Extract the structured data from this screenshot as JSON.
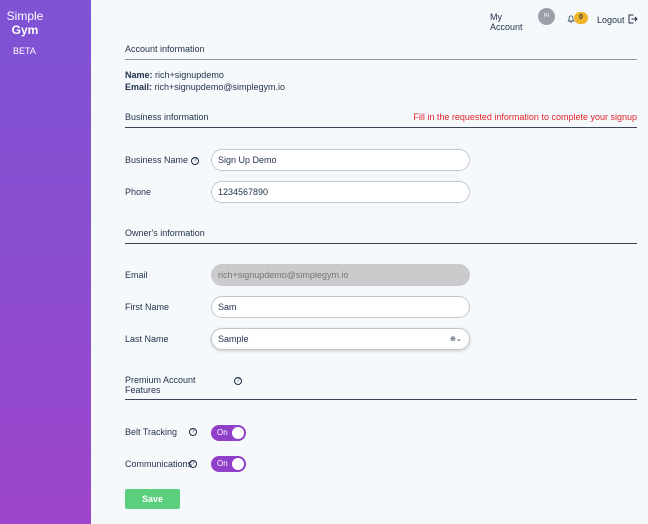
{
  "sidebar": {
    "brand_top": "Simple",
    "brand_bottom": "Gym",
    "beta": "BETA"
  },
  "topbar": {
    "account_label": "My Account",
    "avatar_initials": "RI",
    "notification_count": "0",
    "logout_label": "Logout"
  },
  "account_info": {
    "title": "Account information",
    "name_label": "Name:",
    "name_value": "rich+signupdemo",
    "email_label": "Email:",
    "email_value": "rich+signupdemo@simplegym.io"
  },
  "business_info": {
    "title": "Business information",
    "warning": "Fill in the requested information to complete your signup",
    "business_name_label": "Business Name",
    "business_name_value": "Sign Up Demo",
    "phone_label": "Phone",
    "phone_value": "1234567890"
  },
  "owner_info": {
    "title": "Owner's information",
    "email_label": "Email",
    "email_placeholder": "rich+signupdemo@simplegym.io",
    "first_name_label": "First Name",
    "first_name_value": "Sam",
    "last_name_label": "Last Name",
    "last_name_value": "Sample"
  },
  "premium": {
    "title": "Premium Account Features",
    "belt_tracking_label": "Belt Tracking",
    "belt_tracking_state": "On",
    "communications_label": "Communications",
    "communications_state": "On"
  },
  "actions": {
    "save_label": "Save"
  },
  "colors": {
    "sidebar_top": "#7e53d4",
    "sidebar_bottom": "#9d45cc",
    "toggle_on": "#8f3fc8",
    "save_button": "#5ccf7d",
    "warning": "#e0242a",
    "badge": "#f0b429"
  }
}
